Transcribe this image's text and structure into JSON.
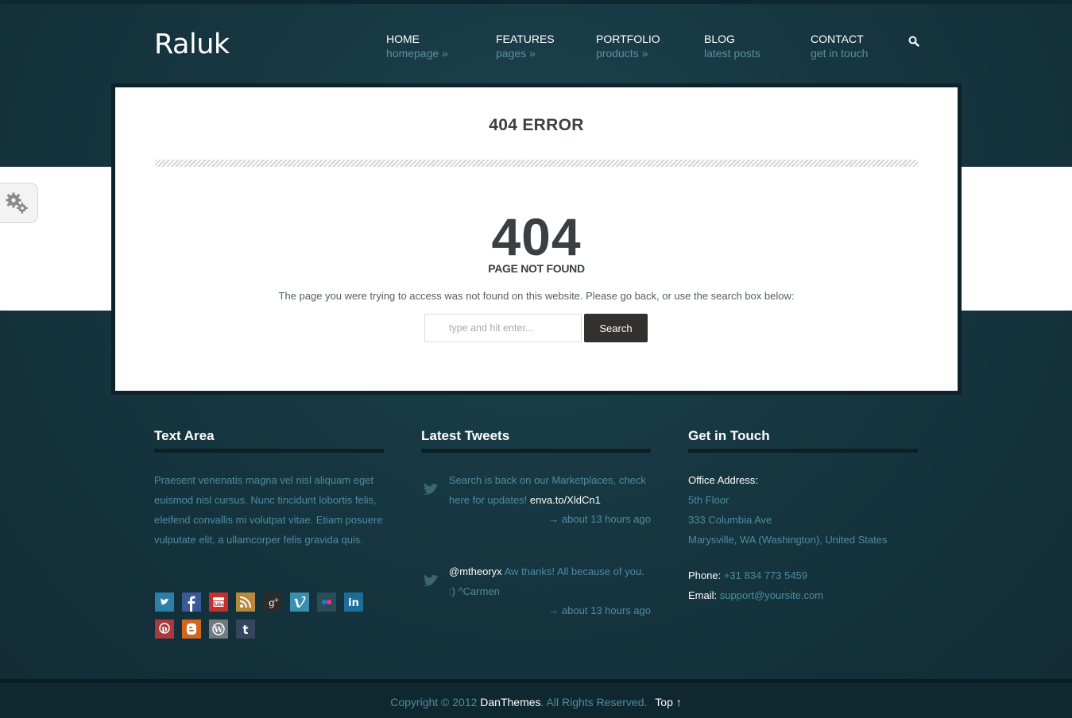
{
  "header": {
    "logo": "Raluk",
    "nav": [
      {
        "title": "HOME",
        "sub": "homepage »"
      },
      {
        "title": "FEATURES",
        "sub": "pages »"
      },
      {
        "title": "PORTFOLIO",
        "sub": "products »"
      },
      {
        "title": "BLOG",
        "sub": "latest posts"
      },
      {
        "title": "CONTACT",
        "sub": "get in touch"
      }
    ],
    "search_icon": "search-icon"
  },
  "settings_tab": {
    "icon": "gears-icon"
  },
  "main": {
    "title": "404 ERROR",
    "code": "404",
    "code_label": "PAGE NOT FOUND",
    "message": "The page you were trying to access was not found on this website. Please go back, or use the search box below:",
    "search": {
      "placeholder": "type and hit enter...",
      "button": "Search"
    }
  },
  "footer": {
    "text_area": {
      "title": "Text Area",
      "body": "Praesent venenatis magna vel nisl aliquam eget euismod nisl cursus. Nunc tincidunt lobortis felis, eleifend convallis mi volutpat vitae. Etiam posuere vulputate elit, a ullamcorper felis gravida quis.",
      "social": [
        "twitter-icon",
        "facebook-icon",
        "youtube-icon",
        "rss-icon",
        "google-plus-icon",
        "vimeo-icon",
        "flickr-icon",
        "linkedin-icon",
        "pinterest-icon",
        "blogger-icon",
        "wordpress-icon",
        "tumblr-icon"
      ]
    },
    "tweets": {
      "title": "Latest Tweets",
      "items": [
        {
          "text": "Search is back on our Marketplaces, check here for updates!",
          "link": "enva.to/XldCn1",
          "time": "→ about 13 hours ago"
        },
        {
          "handle": "@mtheoryx",
          "text": "Aw thanks! All because of you. :) ^Carmen",
          "time": "→ about 13 hours ago"
        }
      ]
    },
    "contact": {
      "title": "Get in Touch",
      "address_label": "Office Address:",
      "address": [
        "5th Floor",
        "333 Columbia Ave",
        "Marysville, WA (Washington), United States"
      ],
      "phone_label": "Phone:",
      "phone": "+31 834 773 5459",
      "email_label": "Email:",
      "email": "support@yoursite.com"
    },
    "copyright_prefix": "Copyright © 2012",
    "copyright_brand": "DanThemes",
    "copyright_suffix": ". All Rights Reserved.",
    "top_link": "Top ↑"
  },
  "colors": {
    "background": "#163641",
    "accent_text": "#4f8ba0",
    "button": "#33312e"
  }
}
